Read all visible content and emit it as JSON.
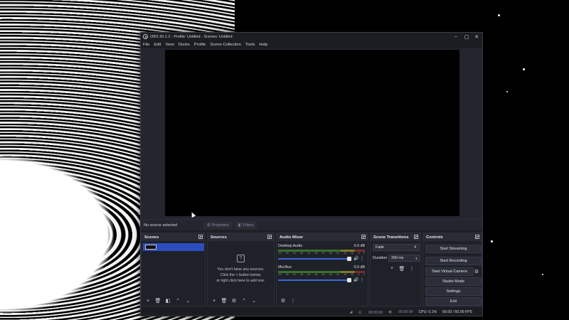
{
  "window": {
    "title": "OBS 30.1.2 - Profile: Untitled - Scenes: Untitled",
    "controls": [
      "–",
      "▢",
      "✕"
    ]
  },
  "menu": [
    "File",
    "Edit",
    "View",
    "Docks",
    "Profile",
    "Scene Collection",
    "Tools",
    "Help"
  ],
  "source_bar": {
    "status": "No source selected",
    "properties_label": "Properties",
    "filters_label": "Filters"
  },
  "docks": {
    "scenes": {
      "title": "Scenes"
    },
    "sources": {
      "title": "Sources",
      "empty_lines": [
        "You don't have any sources.",
        "Click the + button below,",
        "or right click here to add one."
      ]
    },
    "audio_mixer": {
      "title": "Audio Mixer",
      "scale_ticks": [
        "-60",
        "-55",
        "-50",
        "-45",
        "-40",
        "-35",
        "-30",
        "-25",
        "-20",
        "-15",
        "-10",
        "-5",
        "0"
      ],
      "channels": [
        {
          "name": "Desktop Audio",
          "db": "0.0 dB",
          "volume_fraction": 0.98
        },
        {
          "name": "Mic/Aux",
          "db": "0.0 dB",
          "volume_fraction": 0.98
        }
      ]
    },
    "scene_transitions": {
      "title": "Scene Transitions",
      "transition": "Fade",
      "duration_label": "Duration",
      "duration_value": "300 ms"
    },
    "controls": {
      "title": "Controls",
      "buttons": [
        "Start Streaming",
        "Start Recording",
        "Start Virtual Camera",
        "Studio Mode",
        "Settings",
        "Exit"
      ]
    }
  },
  "status_bar": {
    "stream_time": "00:00:00",
    "record_time": "00:00:00",
    "cpu": "CPU: 0.1%",
    "fps": "60.00 / 60.00 FPS"
  },
  "colors": {
    "accent": "#2d4dbf",
    "window_bg": "#1d1f26",
    "panel_title": "#292c35"
  }
}
